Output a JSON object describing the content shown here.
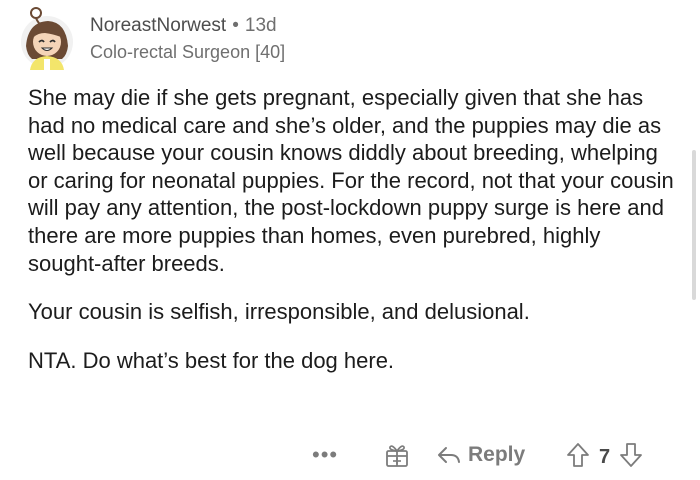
{
  "comment": {
    "username": "NoreastNorwest",
    "separator": "•",
    "age": "13d",
    "flair": "Colo-rectal Surgeon [40]",
    "paragraphs": [
      "She may die if she gets pregnant, especially given that she has had no medical care and she’s older, and the puppies may die as well because your cousin knows diddly about breeding, whelping or caring for neonatal puppies. For the record, not that your cousin will pay any attention, the post-lockdown puppy surge is here and there are more puppies than homes, even purebred, highly sought-after breeds.",
      "Your cousin is selfish, irresponsible, and delusional.",
      "NTA. Do what’s best for the dog here."
    ],
    "actions": {
      "more_label": "•••",
      "reply_label": "Reply",
      "score": "7"
    }
  },
  "icons": {
    "avatar": "avatar",
    "award": "gift-icon",
    "reply": "reply-arrow-icon",
    "upvote": "upvote-arrow-icon",
    "downvote": "downvote-arrow-icon"
  },
  "colors": {
    "text": "#1c1c1c",
    "meta": "#6f6f6f",
    "action": "#7c7c7c"
  }
}
